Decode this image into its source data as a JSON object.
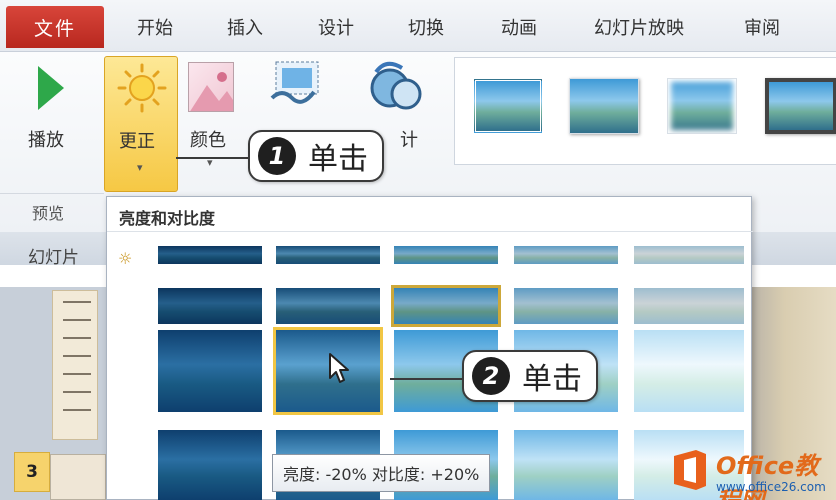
{
  "tabs": {
    "file": "文件",
    "items": [
      "开始",
      "插入",
      "设计",
      "切换",
      "动画",
      "幻灯片放映",
      "审阅"
    ]
  },
  "ribbon": {
    "play_label": "播放",
    "preview_group": "预览",
    "corrections_label": "更正",
    "color_label": "颜色",
    "partial_label": "计",
    "corrections_arrow": "▾",
    "color_arrow": "▾"
  },
  "dropdown": {
    "title": "亮度和对比度"
  },
  "slides_panel": {
    "title": "幻灯片",
    "current_number": "3"
  },
  "callouts": [
    {
      "number": "1",
      "text": "单击"
    },
    {
      "number": "2",
      "text": "单击"
    }
  ],
  "tooltip": "亮度: -20% 对比度: +20%",
  "watermark": {
    "title": "Office教程网",
    "url": "www.office26.com"
  },
  "colors": {
    "file_tab": "#c8352c",
    "selected_button": "#f6c844",
    "selection_outline": "#f1c644"
  },
  "icons": [
    "play-icon",
    "sun-icon",
    "color-icon",
    "artistic-effects-icon",
    "transparency-icon",
    "cursor-icon",
    "sun-small-icon",
    "office-logo-icon"
  ]
}
